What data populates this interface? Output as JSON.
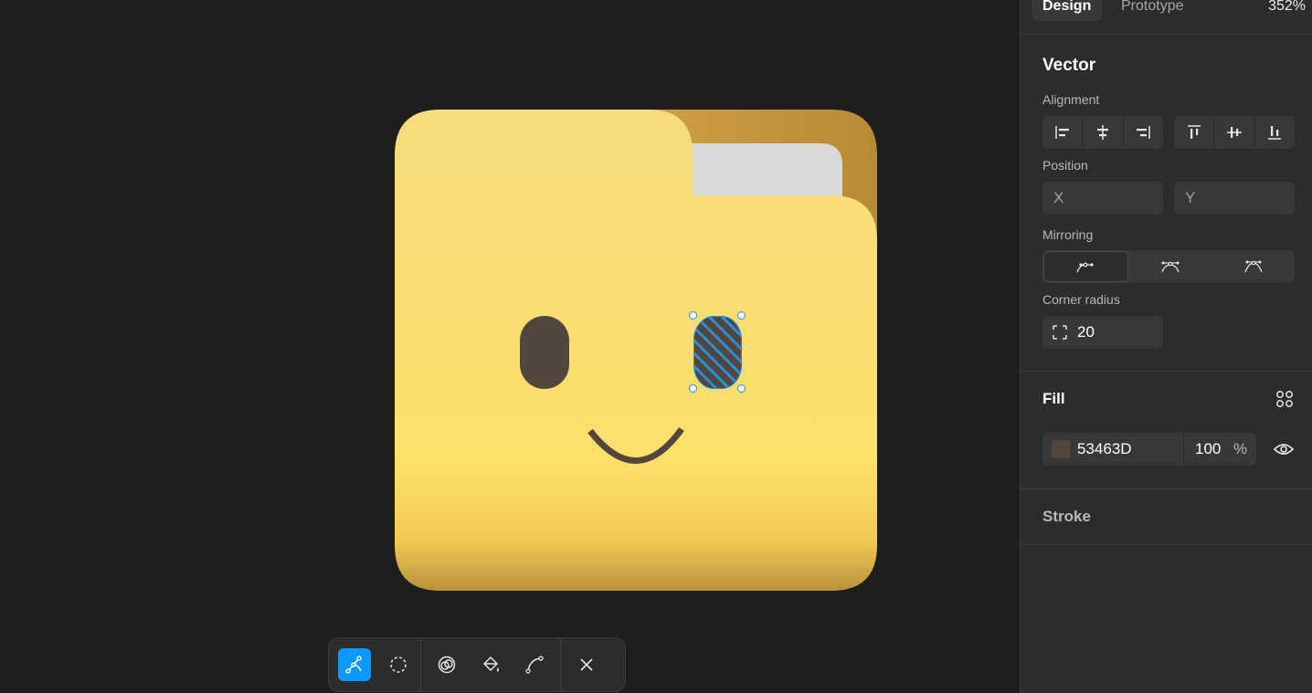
{
  "panel": {
    "tabs": [
      {
        "label": "Design",
        "active": true
      },
      {
        "label": "Prototype",
        "active": false
      }
    ],
    "zoom": "352%",
    "vector": {
      "title": "Vector",
      "alignment_label": "Alignment",
      "alignment_icons": [
        "align-left-icon",
        "align-horizontal-center-icon",
        "align-right-icon",
        "align-top-icon",
        "align-vertical-center-icon",
        "align-bottom-icon"
      ],
      "position_label": "Position",
      "x_placeholder": "X",
      "y_placeholder": "Y",
      "mirroring_label": "Mirroring",
      "mirroring_options": [
        "no-mirroring-icon",
        "mirror-angle-icon",
        "mirror-angle-and-length-icon"
      ],
      "mirroring_selected": 0,
      "corner_radius_label": "Corner radius",
      "corner_radius_value": "20"
    },
    "fill": {
      "title": "Fill",
      "hex": "53463D",
      "opacity": "100",
      "opacity_unit": "%",
      "swatch_color": "#53463D"
    },
    "stroke": {
      "title": "Stroke"
    }
  },
  "toolbar": {
    "tools": [
      "bend-tool-icon",
      "lasso-tool-icon",
      "shape-builder-icon",
      "paint-bucket-icon",
      "cut-path-icon",
      "close-icon"
    ],
    "active_tool": "bend-tool-icon"
  },
  "colors": {
    "accent": "#0d99ff",
    "folder_yellow": "#fddf6d",
    "folder_back": "#c89a40",
    "paper": "#d9d9d9",
    "eye": "#53463D"
  }
}
